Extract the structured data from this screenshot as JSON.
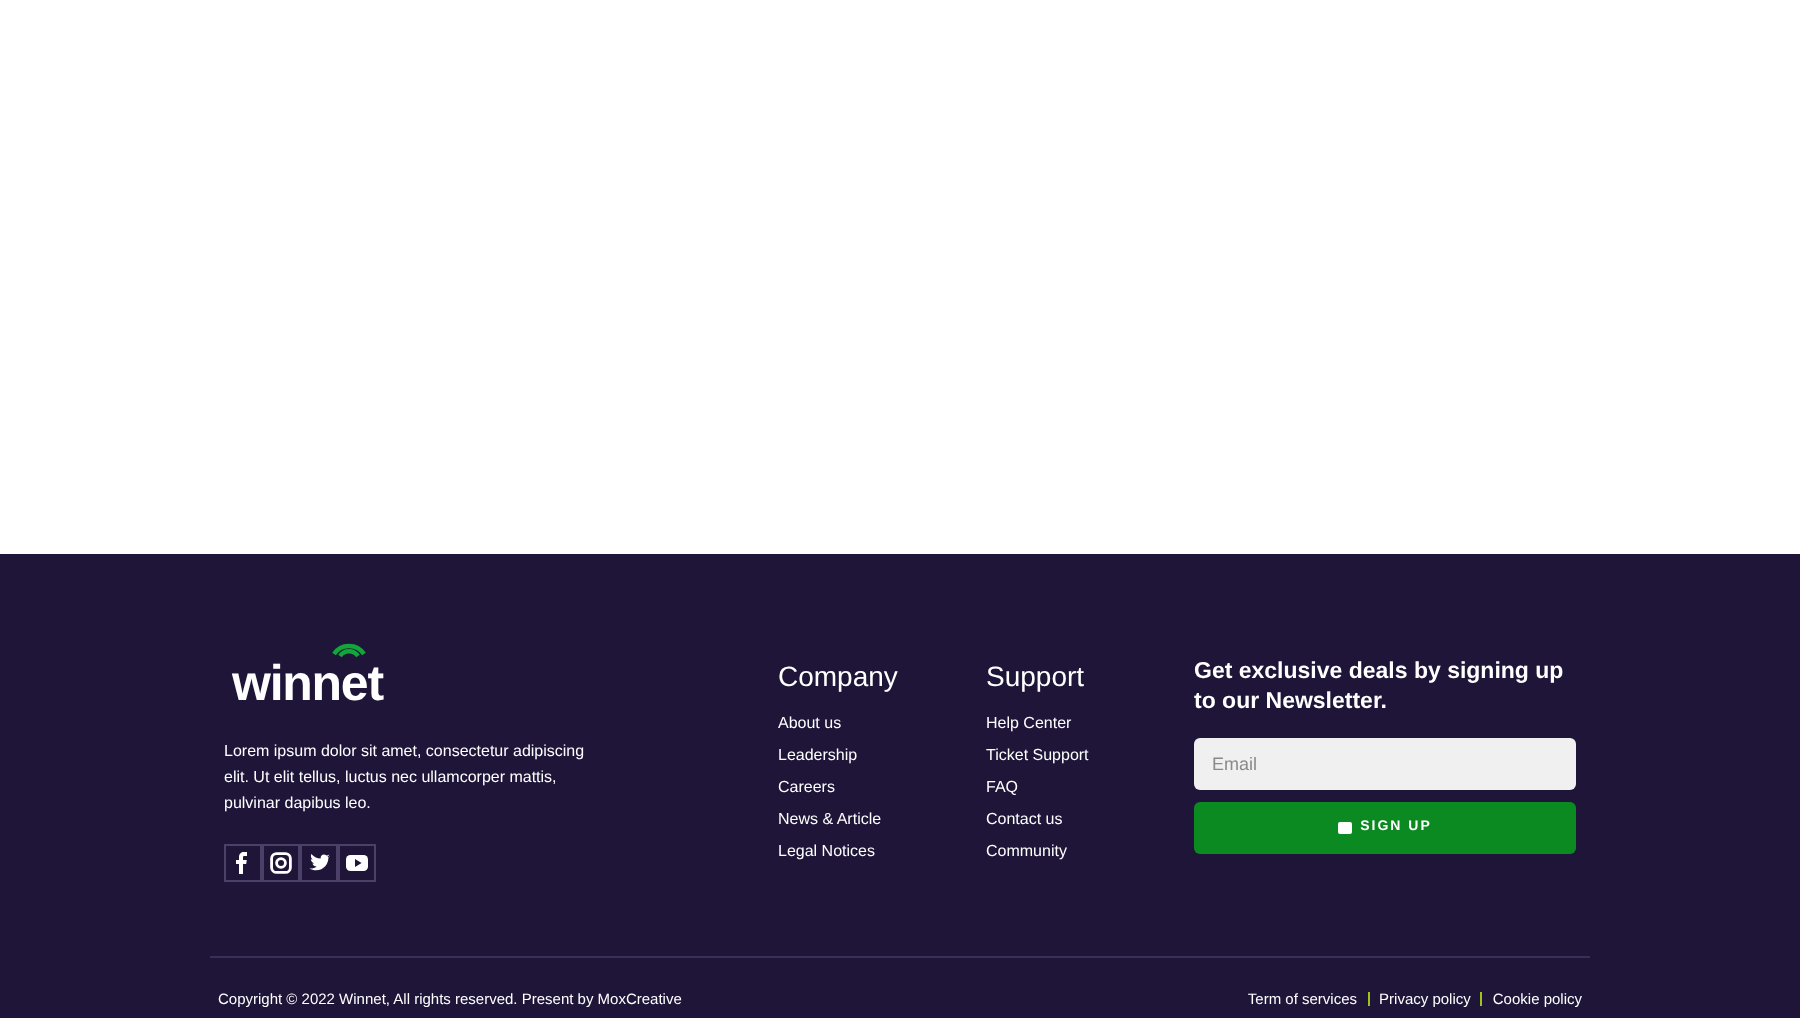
{
  "brand": {
    "logo": "winnet",
    "description": "Lorem ipsum dolor sit amet, consectetur adipiscing elit. Ut elit tellus, luctus nec ullamcorper mattis, pulvinar dapibus leo.",
    "social": [
      {
        "kind": "facebook"
      },
      {
        "kind": "instagram"
      },
      {
        "kind": "twitter"
      },
      {
        "kind": "youtube"
      }
    ]
  },
  "columns": [
    {
      "title": "Company",
      "links": [
        "About us",
        "Leadership",
        "Careers",
        "News & Article",
        "Legal Notices"
      ]
    },
    {
      "title": "Support",
      "links": [
        "Help Center",
        "Ticket Support",
        "FAQ",
        "Contact us",
        "Community"
      ]
    }
  ],
  "newsletter": {
    "heading": "Get exclusive deals by signing up to our Newsletter.",
    "email": {
      "placeholder": "Email"
    },
    "button": "SIGN UP"
  },
  "bottom": {
    "copyright": "Copyright © 2022 Winnet, All rights reserved. Present by MoxCreative",
    "links": [
      "Term of services",
      "Privacy policy",
      "Cookie policy"
    ]
  }
}
